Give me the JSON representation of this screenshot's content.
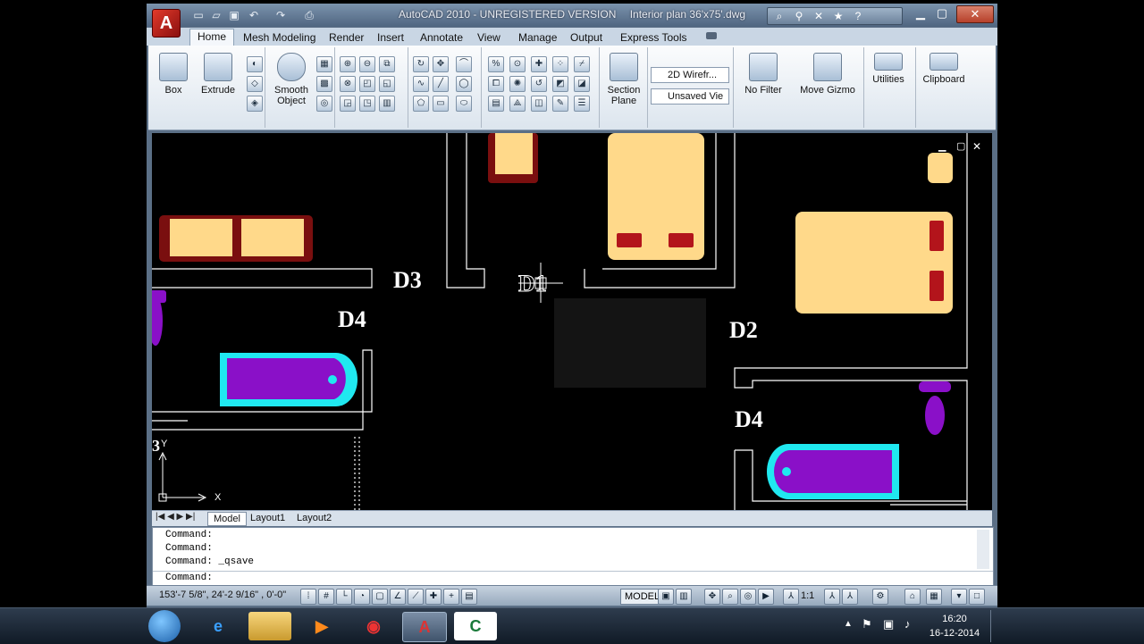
{
  "title": {
    "app": "AutoCAD 2010 - UNREGISTERED VERSION",
    "file": "Interior plan 36'x75'.dwg"
  },
  "ribbon_tabs": [
    "Home",
    "Mesh Modeling",
    "Render",
    "Insert",
    "Annotate",
    "View",
    "Manage",
    "Output",
    "Express Tools"
  ],
  "ribbon": {
    "box": "Box",
    "extrude": "Extrude",
    "smooth_object_1": "Smooth",
    "smooth_object_2": "Object",
    "section_plane_1": "Section",
    "section_plane_2": "Plane",
    "visual_style": "2D Wirefr...",
    "view": "Unsaved Vie",
    "no_filter": "No Filter",
    "move_gizmo": "Move Gizmo",
    "utilities": "Utilities",
    "clipboard": "Clipboard"
  },
  "viewport": {
    "labels": {
      "d3": "D3",
      "d4_left": "D4",
      "d2": "D2",
      "d4_right": "D4",
      "d1": "D1",
      "edge_3": "3"
    },
    "ucs": {
      "x": "X",
      "y": "Y"
    }
  },
  "layout_tabs": [
    "Model",
    "Layout1",
    "Layout2"
  ],
  "command_lines": [
    "Command:",
    "Command:",
    "Command:  _qsave",
    "Command:"
  ],
  "status": {
    "coords": "153'-7 5/8\",  24'-2 9/16\" , 0'-0\"",
    "model": "MODEL",
    "scale": "1:1"
  },
  "clock": {
    "time": "16:20",
    "date": "16-12-2014"
  },
  "colors": {
    "furniture": "#ffd98a",
    "sofa_frame": "#7a0f0f",
    "fixture": "#8a10c8",
    "tub_rim": "#20e8f0",
    "accent_red": "#b3141b"
  }
}
